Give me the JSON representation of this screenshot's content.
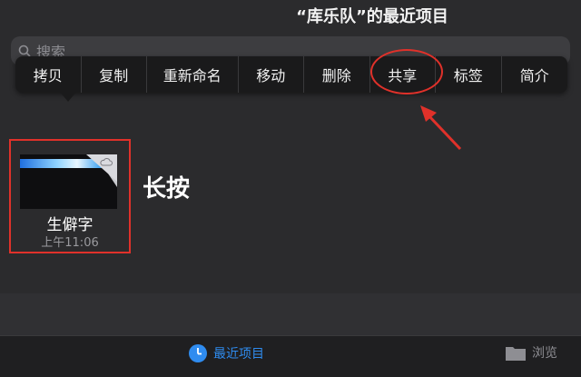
{
  "header": {
    "title": "“库乐队”的最近项目"
  },
  "search": {
    "placeholder": "搜索"
  },
  "context_menu": {
    "items": [
      {
        "label": "拷贝"
      },
      {
        "label": "复制"
      },
      {
        "label": "重新命名"
      },
      {
        "label": "移动"
      },
      {
        "label": "删除"
      },
      {
        "label": "共享"
      },
      {
        "label": "标签"
      },
      {
        "label": "简介"
      }
    ]
  },
  "file": {
    "name": "生僻字",
    "time": "上午11:06"
  },
  "annotation": {
    "longpress_text": "长按"
  },
  "tabbar": {
    "recent_label": "最近项目",
    "browse_label": "浏览"
  },
  "colors": {
    "accent": "#2f8cf0",
    "annotation_red": "#e0312a",
    "background": "#2b2b2d"
  }
}
